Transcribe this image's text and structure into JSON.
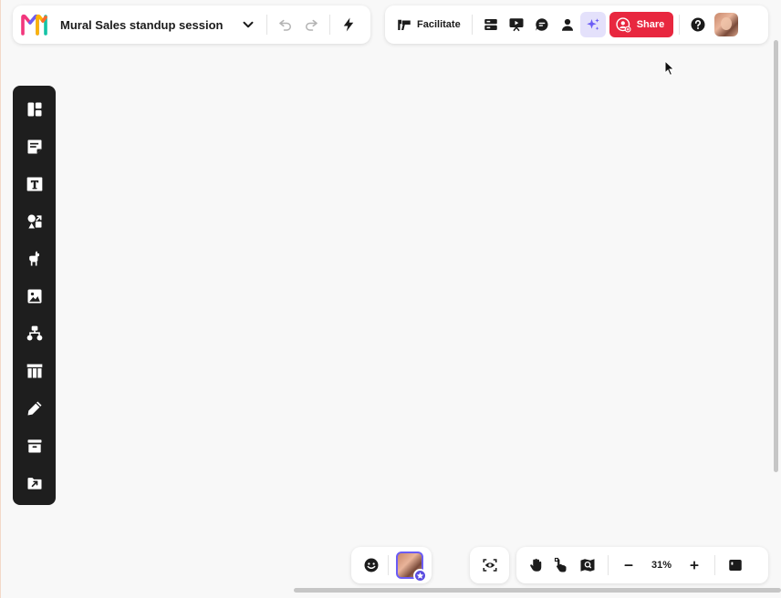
{
  "board": {
    "title": "Mural Sales standup session"
  },
  "top_right": {
    "facilitate_label": "Facilitate",
    "share_label": "Share"
  },
  "zoom": {
    "level": "31%"
  },
  "colors": {
    "share": "#e8273f",
    "ai_bg": "#e4e1fb",
    "toolbar_bg": "#1e1e1e",
    "accent": "#5b4de0"
  },
  "left_toolbar": {
    "tools": [
      {
        "icon": "templates-icon"
      },
      {
        "icon": "sticky-note-icon"
      },
      {
        "icon": "text-icon"
      },
      {
        "icon": "shapes-icon"
      },
      {
        "icon": "llama-icon"
      },
      {
        "icon": "image-icon"
      },
      {
        "icon": "diagram-icon"
      },
      {
        "icon": "table-icon"
      },
      {
        "icon": "pen-icon"
      },
      {
        "icon": "archive-icon"
      },
      {
        "icon": "export-icon"
      }
    ]
  }
}
